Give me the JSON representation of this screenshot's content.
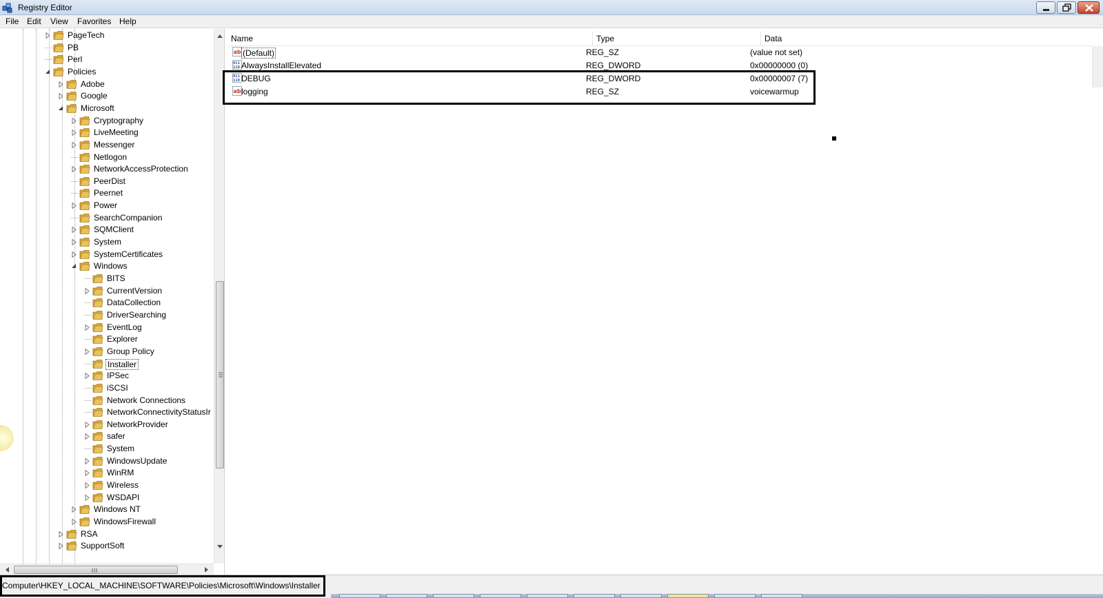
{
  "window": {
    "title": "Registry Editor"
  },
  "menu": [
    "File",
    "Edit",
    "View",
    "Favorites",
    "Help"
  ],
  "tree": [
    {
      "label": "PageTech",
      "level": 0,
      "expander": "collapsed"
    },
    {
      "label": "PB",
      "level": 0,
      "expander": "none"
    },
    {
      "label": "Perl",
      "level": 0,
      "expander": "none"
    },
    {
      "label": "Policies",
      "level": 0,
      "expander": "expanded"
    },
    {
      "label": "Adobe",
      "level": 1,
      "expander": "collapsed"
    },
    {
      "label": "Google",
      "level": 1,
      "expander": "collapsed"
    },
    {
      "label": "Microsoft",
      "level": 1,
      "expander": "expanded"
    },
    {
      "label": "Cryptography",
      "level": 2,
      "expander": "collapsed"
    },
    {
      "label": "LiveMeeting",
      "level": 2,
      "expander": "collapsed"
    },
    {
      "label": "Messenger",
      "level": 2,
      "expander": "collapsed"
    },
    {
      "label": "Netlogon",
      "level": 2,
      "expander": "none"
    },
    {
      "label": "NetworkAccessProtection",
      "level": 2,
      "expander": "collapsed"
    },
    {
      "label": "PeerDist",
      "level": 2,
      "expander": "none"
    },
    {
      "label": "Peernet",
      "level": 2,
      "expander": "none"
    },
    {
      "label": "Power",
      "level": 2,
      "expander": "collapsed"
    },
    {
      "label": "SearchCompanion",
      "level": 2,
      "expander": "none"
    },
    {
      "label": "SQMClient",
      "level": 2,
      "expander": "collapsed"
    },
    {
      "label": "System",
      "level": 2,
      "expander": "collapsed"
    },
    {
      "label": "SystemCertificates",
      "level": 2,
      "expander": "collapsed"
    },
    {
      "label": "Windows",
      "level": 2,
      "expander": "expanded"
    },
    {
      "label": "BITS",
      "level": 3,
      "expander": "none"
    },
    {
      "label": "CurrentVersion",
      "level": 3,
      "expander": "collapsed"
    },
    {
      "label": "DataCollection",
      "level": 3,
      "expander": "none"
    },
    {
      "label": "DriverSearching",
      "level": 3,
      "expander": "none"
    },
    {
      "label": "EventLog",
      "level": 3,
      "expander": "collapsed"
    },
    {
      "label": "Explorer",
      "level": 3,
      "expander": "none"
    },
    {
      "label": "Group Policy",
      "level": 3,
      "expander": "collapsed"
    },
    {
      "label": "Installer",
      "level": 3,
      "expander": "none",
      "selected": true
    },
    {
      "label": "IPSec",
      "level": 3,
      "expander": "collapsed"
    },
    {
      "label": "iSCSI",
      "level": 3,
      "expander": "none"
    },
    {
      "label": "Network Connections",
      "level": 3,
      "expander": "none"
    },
    {
      "label": "NetworkConnectivityStatusIr",
      "level": 3,
      "expander": "none"
    },
    {
      "label": "NetworkProvider",
      "level": 3,
      "expander": "collapsed"
    },
    {
      "label": "safer",
      "level": 3,
      "expander": "collapsed"
    },
    {
      "label": "System",
      "level": 3,
      "expander": "none"
    },
    {
      "label": "WindowsUpdate",
      "level": 3,
      "expander": "collapsed"
    },
    {
      "label": "WinRM",
      "level": 3,
      "expander": "collapsed"
    },
    {
      "label": "Wireless",
      "level": 3,
      "expander": "collapsed"
    },
    {
      "label": "WSDAPI",
      "level": 3,
      "expander": "collapsed"
    },
    {
      "label": "Windows NT",
      "level": 2,
      "expander": "collapsed"
    },
    {
      "label": "WindowsFirewall",
      "level": 2,
      "expander": "collapsed"
    },
    {
      "label": "RSA",
      "level": 1,
      "expander": "collapsed"
    },
    {
      "label": "SupportSoft",
      "level": 1,
      "expander": "collapsed"
    }
  ],
  "columns": {
    "name": "Name",
    "type": "Type",
    "data": "Data"
  },
  "values": [
    {
      "name": "(Default)",
      "type": "REG_SZ",
      "data": "(value not set)",
      "icon": "string-value-icon"
    },
    {
      "name": "AlwaysInstallElevated",
      "type": "REG_DWORD",
      "data": "0x00000000 (0)",
      "icon": "dword-value-icon"
    },
    {
      "name": "DEBUG",
      "type": "REG_DWORD",
      "data": "0x00000007 (7)",
      "icon": "dword-value-icon"
    },
    {
      "name": "logging",
      "type": "REG_SZ",
      "data": "voicewarmup",
      "icon": "string-value-icon"
    }
  ],
  "status": {
    "path": "Computer\\HKEY_LOCAL_MACHINE\\SOFTWARE\\Policies\\Microsoft\\Windows\\Installer"
  },
  "colors": {
    "folder": "#e8c25a",
    "highlight_border": "#000000",
    "string_icon": "#c0392b",
    "dword_icon": "#2c4f8c"
  }
}
